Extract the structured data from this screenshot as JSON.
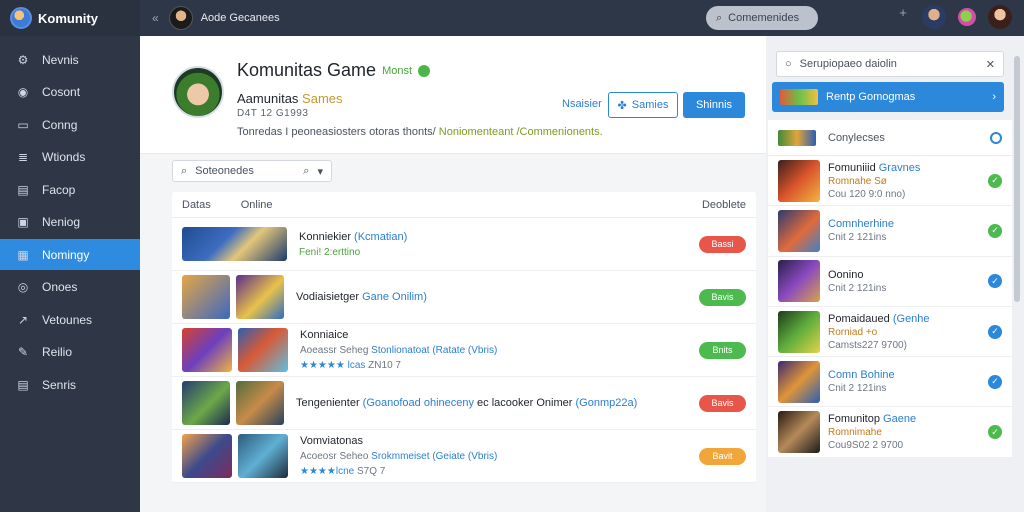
{
  "topbar": {
    "brand": "Komunity",
    "collapse_glyph": "«",
    "user_label": "Aode Gecanees",
    "search_label": "Comemenides",
    "plus_glyph": "+"
  },
  "sidebar": {
    "items": [
      {
        "label": "Nevnis",
        "icon": "⚙"
      },
      {
        "label": "Cosont",
        "icon": "◉"
      },
      {
        "label": "Conng",
        "icon": "▭"
      },
      {
        "label": "Wtionds",
        "icon": "≣"
      },
      {
        "label": "Facop",
        "icon": "▤"
      },
      {
        "label": "Neniog",
        "icon": "▣"
      },
      {
        "label": "Nomingy",
        "icon": "▦"
      },
      {
        "label": "Onoes",
        "icon": "◎"
      },
      {
        "label": "Vetounes",
        "icon": "↗"
      },
      {
        "label": "Reilio",
        "icon": "✎"
      },
      {
        "label": "Senris",
        "icon": "▤"
      }
    ],
    "active_index": 6
  },
  "profile": {
    "title": "Komunitas Game",
    "tag": "Monst",
    "subtitle_prefix": "Aamunitas",
    "subtitle_highlight": "Sames",
    "meta": "D4T 12 G1993",
    "desc_prefix": "Tonredas I peoneasiosters otoras thonts/",
    "desc_highlight": "Noniomenteant /Commenionents.",
    "link_label": "Nsaisier",
    "btn_outline": "Samies",
    "btn_primary": "Shinnis"
  },
  "filter": {
    "placeholder": "Soteonedes",
    "search_glyph": "⌕",
    "caret": "▾"
  },
  "table": {
    "headers": [
      "Datas",
      "Online",
      "Deoblete"
    ],
    "rows": [
      {
        "line1_a": "Konniekier",
        "line1_b": "(Kcmatian)",
        "line2": "Feni! 2:erttino",
        "status": "Bassi",
        "status_color": "red"
      },
      {
        "line1_a": "Vodiaisietger",
        "line1_b": "Gane Onilim)",
        "status": "Bavis",
        "status_color": "green"
      },
      {
        "line1_a": "Konniaice",
        "line2_a": "Aoeassr Seheg",
        "line2_b": "Stonlionatoat",
        "line2_c": "(Ratate (Vbris)",
        "stars": "★★★★★ lcas",
        "line3": "ZN10 7",
        "status": "Bnits",
        "status_color": "green"
      },
      {
        "line1_a": "Tengenienter",
        "line1_b": "(Goanofoad ohineceny",
        "line1_c": "ec lacooker Onimer",
        "line1_d": "(Gonmp22a)",
        "status": "Bavis",
        "status_color": "red"
      },
      {
        "line1_a": "Vomviatonas",
        "line2_a": "Acoeosr Seheo",
        "line2_b": "Srokmmeiset",
        "line2_c": "(Geiate (Vbris)",
        "stars": "★★★★lcne",
        "line3": "S7Q 7",
        "status": "Bavit",
        "status_color": "orange"
      }
    ]
  },
  "rpanel": {
    "search_placeholder": "Serupiopaeo daiolin",
    "close_glyph": "✕",
    "header_label": "Rentp Gomogmas",
    "header_chevron": "›",
    "list_head": "Conylecses",
    "items": [
      {
        "line1": "Fomuniiid",
        "line1_b": "Gravnes",
        "line2": "Romnahe",
        "line2_b": "Sø",
        "line3": "Cou 120 9:0 nno)",
        "status": "g"
      },
      {
        "line1_b": "Comnherhine",
        "line2": "Cnit 2 121ins",
        "status": "g"
      },
      {
        "line1": "Oonino",
        "line2": "Cnit 2 121ins",
        "status": "b"
      },
      {
        "line1": "Pomaidaued",
        "line1_b": "(Genhe",
        "line2": "Rorniad",
        "line2_b": "+o",
        "line3": "Camsts227 9700)",
        "status": "b"
      },
      {
        "line1_b": "Comn Bohine",
        "line2": "Cnit 2 121ins",
        "status": "b"
      },
      {
        "line1": "Fomunitop",
        "line1_b": "Gaene",
        "line2": "Romnimahe",
        "line3": "Cou9S02 2 9700",
        "status": "g"
      }
    ]
  },
  "colors": {
    "accent": "#2b88db",
    "sidebar_bg": "#2f3746",
    "topbar_bg": "#2e3747",
    "success": "#4cba4f",
    "danger": "#e8564a",
    "warning": "#f0a638"
  }
}
